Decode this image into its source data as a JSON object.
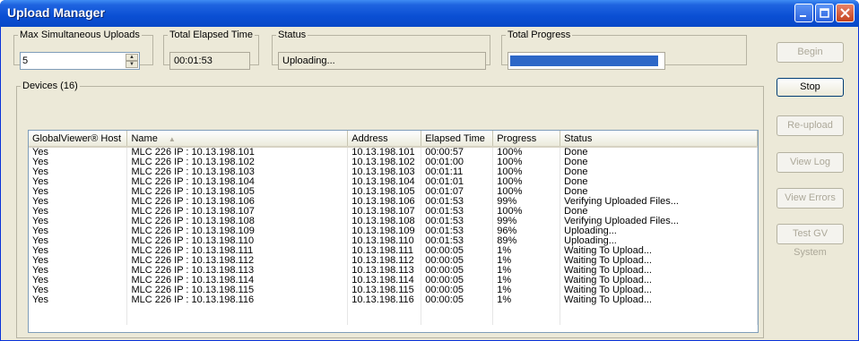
{
  "window": {
    "title": "Upload Manager"
  },
  "max_uploads": {
    "legend": "Max Simultaneous Uploads",
    "value": "5"
  },
  "elapsed": {
    "legend": "Total Elapsed Time",
    "value": "00:01:53"
  },
  "status": {
    "legend": "Status",
    "value": "Uploading..."
  },
  "total_progress": {
    "legend": "Total Progress",
    "fraction": 0.97
  },
  "devices": {
    "legend": "Devices (16)",
    "columns": [
      "GlobalViewer® Host",
      "Name",
      "Address",
      "Elapsed Time",
      "Progress",
      "Status"
    ],
    "rows": [
      [
        "Yes",
        "MLC 226 IP : 10.13.198.101",
        "10.13.198.101",
        "00:00:57",
        "100%",
        "Done"
      ],
      [
        "Yes",
        "MLC 226 IP : 10.13.198.102",
        "10.13.198.102",
        "00:01:00",
        "100%",
        "Done"
      ],
      [
        "Yes",
        "MLC 226 IP : 10.13.198.103",
        "10.13.198.103",
        "00:01:11",
        "100%",
        "Done"
      ],
      [
        "Yes",
        "MLC 226 IP : 10.13.198.104",
        "10.13.198.104",
        "00:01:01",
        "100%",
        "Done"
      ],
      [
        "Yes",
        "MLC 226 IP : 10.13.198.105",
        "10.13.198.105",
        "00:01:07",
        "100%",
        "Done"
      ],
      [
        "Yes",
        "MLC 226 IP : 10.13.198.106",
        "10.13.198.106",
        "00:01:53",
        "99%",
        "Verifying Uploaded Files..."
      ],
      [
        "Yes",
        "MLC 226 IP : 10.13.198.107",
        "10.13.198.107",
        "00:01:53",
        "100%",
        "Done"
      ],
      [
        "Yes",
        "MLC 226 IP : 10.13.198.108",
        "10.13.198.108",
        "00:01:53",
        "99%",
        "Verifying Uploaded Files..."
      ],
      [
        "Yes",
        "MLC 226 IP : 10.13.198.109",
        "10.13.198.109",
        "00:01:53",
        "96%",
        "Uploading..."
      ],
      [
        "Yes",
        "MLC 226 IP : 10.13.198.110",
        "10.13.198.110",
        "00:01:53",
        "89%",
        "Uploading..."
      ],
      [
        "Yes",
        "MLC 226 IP : 10.13.198.111",
        "10.13.198.111",
        "00:00:05",
        "1%",
        "Waiting To Upload..."
      ],
      [
        "Yes",
        "MLC 226 IP : 10.13.198.112",
        "10.13.198.112",
        "00:00:05",
        "1%",
        "Waiting To Upload..."
      ],
      [
        "Yes",
        "MLC 226 IP : 10.13.198.113",
        "10.13.198.113",
        "00:00:05",
        "1%",
        "Waiting To Upload..."
      ],
      [
        "Yes",
        "MLC 226 IP : 10.13.198.114",
        "10.13.198.114",
        "00:00:05",
        "1%",
        "Waiting To Upload..."
      ],
      [
        "Yes",
        "MLC 226 IP : 10.13.198.115",
        "10.13.198.115",
        "00:00:05",
        "1%",
        "Waiting To Upload..."
      ],
      [
        "Yes",
        "MLC 226 IP : 10.13.198.116",
        "10.13.198.116",
        "00:00:05",
        "1%",
        "Waiting To Upload..."
      ]
    ]
  },
  "buttons": {
    "begin": "Begin",
    "stop": "Stop",
    "reupload": "Re-upload",
    "view_log": "View Log",
    "view_errors": "View Errors",
    "test_gv": "Test GV System"
  },
  "icons": {
    "minimize": "minimize-icon",
    "maximize": "maximize-icon",
    "close": "close-icon",
    "sort": "sort-ascending-icon"
  },
  "colors": {
    "title_bar": "#0a4fd4",
    "progress_fill": "#2d67c7",
    "close_button": "#c4421d"
  }
}
